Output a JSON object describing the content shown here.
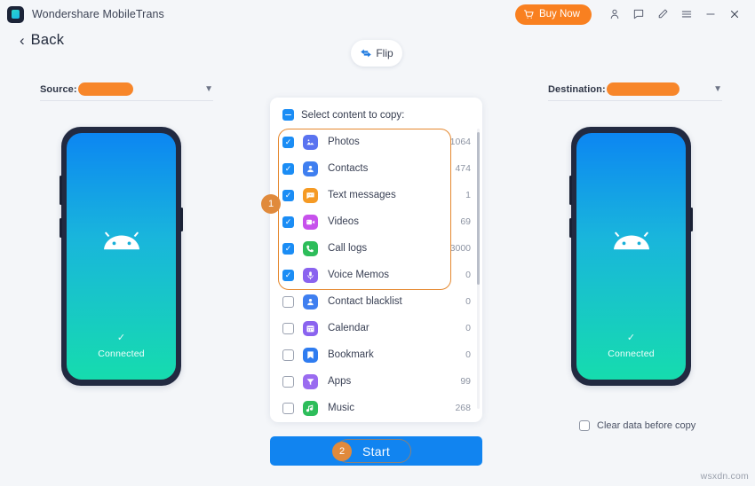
{
  "window": {
    "app_title": "Wondershare MobileTrans",
    "logo_icon": "mobiletrans-logo-icon",
    "buy_now_label": "Buy Now",
    "cart_icon": "cart-icon",
    "toolbar_icons": [
      {
        "name": "account-icon",
        "glyph": "person"
      },
      {
        "name": "feedback-icon",
        "glyph": "chat"
      },
      {
        "name": "edit-icon",
        "glyph": "pen"
      },
      {
        "name": "menu-icon",
        "glyph": "hamburger"
      },
      {
        "name": "minimize-icon",
        "glyph": "minimize"
      },
      {
        "name": "close-icon",
        "glyph": "close"
      }
    ]
  },
  "nav": {
    "back_label": "Back",
    "back_icon": "chevron-left-icon"
  },
  "flip": {
    "label": "Flip",
    "icon": "flip-arrows-icon"
  },
  "source_panel": {
    "label": "Source:",
    "device_name_redacted": "",
    "chevron_icon": "chevron-down-icon",
    "phone": {
      "status_text": "Connected",
      "status_icon": "check-icon",
      "os_icon": "android-robot-icon",
      "screen_gradient_top": "#0c86f2",
      "screen_gradient_bottom": "#16dcae"
    }
  },
  "destination_panel": {
    "label": "Destination:",
    "device_name_redacted": "",
    "chevron_icon": "chevron-down-icon",
    "phone": {
      "status_text": "Connected",
      "status_icon": "check-icon",
      "os_icon": "android-robot-icon",
      "screen_gradient_top": "#0c86f2",
      "screen_gradient_bottom": "#16dcae"
    },
    "clear_data_label": "Clear data before copy",
    "clear_data_checked": false
  },
  "content_card": {
    "header_label": "Select content to copy:",
    "header_checkbox_state": "indeterminate",
    "items": [
      {
        "label": "Photos",
        "count": "1064",
        "checked": true,
        "icon": "photos-icon",
        "color": "#5a73f0"
      },
      {
        "label": "Contacts",
        "count": "474",
        "checked": true,
        "icon": "contacts-icon",
        "color": "#3f7ff0"
      },
      {
        "label": "Text messages",
        "count": "1",
        "checked": true,
        "icon": "text-messages-icon",
        "color": "#f59a24"
      },
      {
        "label": "Videos",
        "count": "69",
        "checked": true,
        "icon": "videos-icon",
        "color": "#c751ec"
      },
      {
        "label": "Call logs",
        "count": "3000",
        "checked": true,
        "icon": "call-logs-icon",
        "color": "#2dbd5a"
      },
      {
        "label": "Voice Memos",
        "count": "0",
        "checked": true,
        "icon": "voice-memos-icon",
        "color": "#8a63ef"
      },
      {
        "label": "Contact blacklist",
        "count": "0",
        "checked": false,
        "icon": "contact-blacklist-icon",
        "color": "#3f7ff0"
      },
      {
        "label": "Calendar",
        "count": "0",
        "checked": false,
        "icon": "calendar-icon",
        "color": "#8a63ef"
      },
      {
        "label": "Bookmark",
        "count": "0",
        "checked": false,
        "icon": "bookmark-icon",
        "color": "#2f7cf0"
      },
      {
        "label": "Apps",
        "count": "99",
        "checked": false,
        "icon": "apps-icon",
        "color": "#9a6bf0"
      },
      {
        "label": "Music",
        "count": "268",
        "checked": false,
        "icon": "music-icon",
        "color": "#2dbd5a"
      }
    ]
  },
  "actions": {
    "start_label": "Start"
  },
  "annotations": [
    {
      "badge": "1",
      "target": "selected-content-group"
    },
    {
      "badge": "2",
      "target": "start-button"
    }
  ],
  "watermark": {
    "text": "wsxdn.com"
  },
  "theme": {
    "accent_blue": "#1184f0",
    "accent_orange": "#f98020",
    "annotation_orange": "#e5882f",
    "background": "#f4f6f9"
  }
}
